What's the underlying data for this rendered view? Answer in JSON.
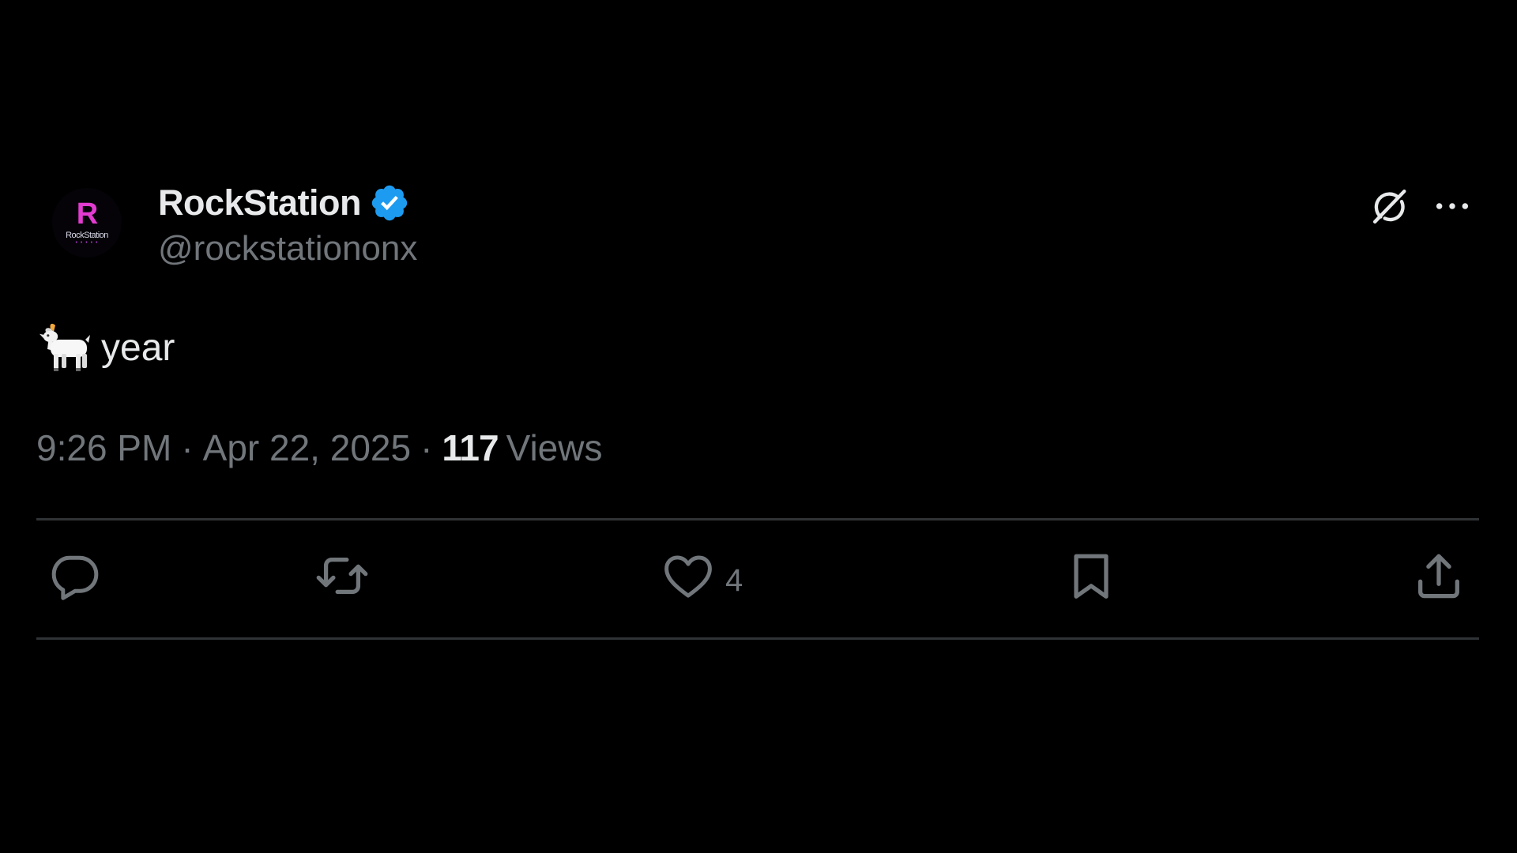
{
  "author": {
    "display_name": "RockStation",
    "handle": "@rockstationonx",
    "verified": true,
    "avatar": {
      "logo_letter": "R",
      "logo_word": "RockStation",
      "logo_sub": "• • • • •"
    }
  },
  "header_actions": {
    "grok_icon": "grok-icon",
    "more_icon": "more-horizontal-icon"
  },
  "tweet": {
    "emoji": "goat-emoji",
    "text": "year"
  },
  "meta": {
    "time": "9:26 PM",
    "separator": "·",
    "date": "Apr 22, 2025",
    "views_count": "117",
    "views_label": "Views"
  },
  "actions": {
    "reply": {
      "icon": "reply-icon",
      "count": ""
    },
    "retweet": {
      "icon": "retweet-icon",
      "count": ""
    },
    "like": {
      "icon": "heart-icon",
      "count": "4"
    },
    "bookmark": {
      "icon": "bookmark-icon",
      "count": ""
    },
    "share": {
      "icon": "share-icon",
      "count": ""
    }
  },
  "colors": {
    "background": "#000000",
    "text_primary": "#e7e9ea",
    "text_secondary": "#71767b",
    "verified_blue": "#1d9bf0",
    "divider": "#2f3336",
    "logo_pink": "#e23bd0"
  }
}
